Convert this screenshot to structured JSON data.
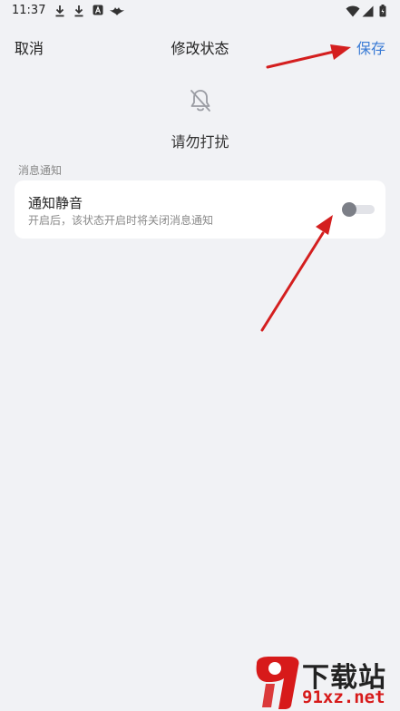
{
  "status_bar": {
    "time": "11:37",
    "left_icons": [
      "download-icon",
      "download-icon",
      "app-a-icon",
      "bird-app-icon"
    ],
    "right_icons": [
      "wifi-icon",
      "signal-icon",
      "battery-icon"
    ]
  },
  "header": {
    "cancel_label": "取消",
    "title": "修改状态",
    "save_label": "保存"
  },
  "status": {
    "icon": "bell-off-icon",
    "name": "请勿打扰"
  },
  "notification_section": {
    "label": "消息通知",
    "item": {
      "title": "通知静音",
      "description": "开启后，该状态开启时将关闭消息通知",
      "enabled": false
    }
  },
  "watermark": {
    "line1": "下载站",
    "line2": "91xz.net"
  },
  "colors": {
    "background": "#f1f2f5",
    "accent": "#3a7bd5",
    "arrow": "#d41f1f"
  }
}
